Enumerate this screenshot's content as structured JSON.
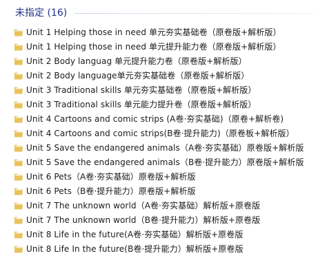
{
  "group": {
    "title": "未指定 (16)"
  },
  "items": [
    {
      "name": "Unit 1 Helping those in need 单元夯实基础卷（原卷版+解析版）",
      "icon": "folder-icon"
    },
    {
      "name": "Unit 1 Helping those in need 单元提升能力卷（原卷版+解析版）",
      "icon": "folder-icon"
    },
    {
      "name": "Unit 2 Body languag 单元提升能力卷（原卷版+解析版）",
      "icon": "folder-icon"
    },
    {
      "name": "Unit 2 Body language单元夯实基础卷（原卷版+解析版）",
      "icon": "folder-icon"
    },
    {
      "name": "Unit 3 Traditional skills 单元夯实基础卷（原卷版+解析版）",
      "icon": "folder-icon"
    },
    {
      "name": "Unit 3 Traditional skills 单元能力提升卷（原卷版+解析版）",
      "icon": "folder-icon"
    },
    {
      "name": "Unit 4 Cartoons and comic strips (A卷·夯实基础)（原卷+解析卷)",
      "icon": "folder-icon"
    },
    {
      "name": "Unit 4 Cartoons and comic strips(B卷·提升能力)（原卷板+解析版）",
      "icon": "folder-icon"
    },
    {
      "name": "Unit 5 Save the endangered animals（A卷·夯实基础）原卷版+解析版",
      "icon": "folder-icon"
    },
    {
      "name": "Unit 5 Save the endangered animals（B卷·提升能力）原卷版+解析版",
      "icon": "folder-icon"
    },
    {
      "name": "Unit 6 Pets（A卷·夯实基础）原卷版+解析版",
      "icon": "folder-icon"
    },
    {
      "name": "Unit 6 Pets（B卷·提升能力）原卷版+解析版",
      "icon": "folder-icon"
    },
    {
      "name": "Unit 7 The unknown world（A卷·夯实基础）解析版+原卷版",
      "icon": "folder-icon"
    },
    {
      "name": "Unit 7 The unknown world（B卷·提升能力）解析版+原卷版",
      "icon": "folder-icon"
    },
    {
      "name": "Unit 8 Life in the future(A卷·夯实基础）解析版+原卷版",
      "icon": "folder-icon"
    },
    {
      "name": "Unit 8 Life In the future(B卷·提升能力）解析版+原卷版",
      "icon": "folder-icon"
    }
  ],
  "colors": {
    "group_title": "#1e3287",
    "folder_body": "#e8c35a",
    "folder_tab": "#d9a93a",
    "folder_paper": "#f7f3e6",
    "text": "#1a1a1a"
  }
}
